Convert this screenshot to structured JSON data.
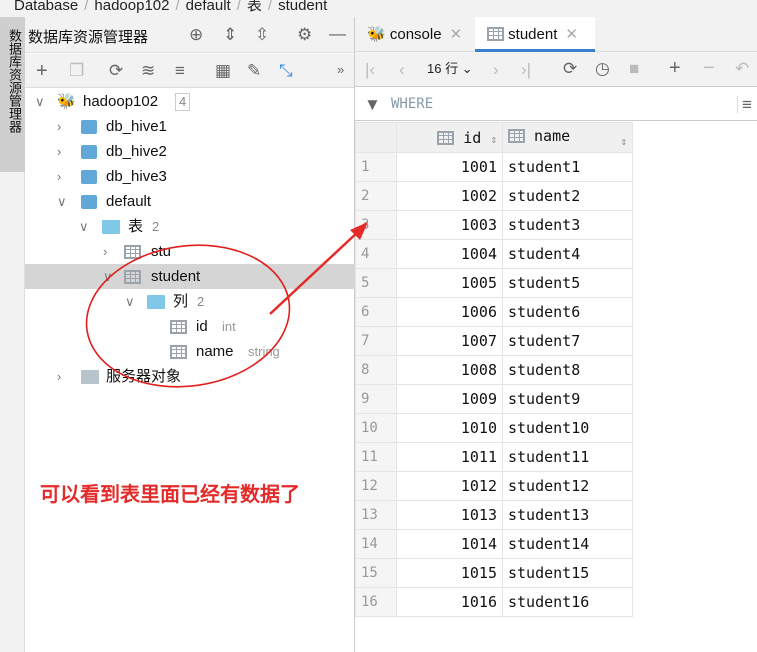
{
  "breadcrumb": [
    "Database",
    "hadoop102",
    "default",
    "表",
    "student"
  ],
  "side_strip": {
    "label": "数据库资源管理器"
  },
  "explorer": {
    "title": "数据库资源管理器",
    "tree": [
      {
        "label": "hadoop102",
        "count": "4"
      },
      {
        "label": "db_hive1"
      },
      {
        "label": "db_hive2"
      },
      {
        "label": "db_hive3"
      },
      {
        "label": "default"
      },
      {
        "label": "表",
        "count": "2"
      },
      {
        "label": "stu"
      },
      {
        "label": "student"
      },
      {
        "label": "列",
        "count": "2"
      },
      {
        "label": "id",
        "type": "int"
      },
      {
        "label": "name",
        "type": "string"
      },
      {
        "label": "服务器对象"
      }
    ]
  },
  "tabs": [
    {
      "label": "console"
    },
    {
      "label": "student",
      "active": true
    }
  ],
  "grid_toolbar": {
    "rows": "16 行"
  },
  "filter": {
    "placeholder": "WHERE"
  },
  "table": {
    "columns": [
      "id",
      "name"
    ],
    "rows": [
      [
        "1",
        "1001",
        "student1"
      ],
      [
        "2",
        "1002",
        "student2"
      ],
      [
        "3",
        "1003",
        "student3"
      ],
      [
        "4",
        "1004",
        "student4"
      ],
      [
        "5",
        "1005",
        "student5"
      ],
      [
        "6",
        "1006",
        "student6"
      ],
      [
        "7",
        "1007",
        "student7"
      ],
      [
        "8",
        "1008",
        "student8"
      ],
      [
        "9",
        "1009",
        "student9"
      ],
      [
        "10",
        "1010",
        "student10"
      ],
      [
        "11",
        "1011",
        "student11"
      ],
      [
        "12",
        "1012",
        "student12"
      ],
      [
        "13",
        "1013",
        "student13"
      ],
      [
        "14",
        "1014",
        "student14"
      ],
      [
        "15",
        "1015",
        "student15"
      ],
      [
        "16",
        "1016",
        "student16"
      ]
    ]
  },
  "annotation": {
    "text": "可以看到表里面已经有数据了",
    "color": "#e52a2a"
  },
  "colors": {
    "accent": "#3b7fd0",
    "selection": "#d5d5d5"
  }
}
